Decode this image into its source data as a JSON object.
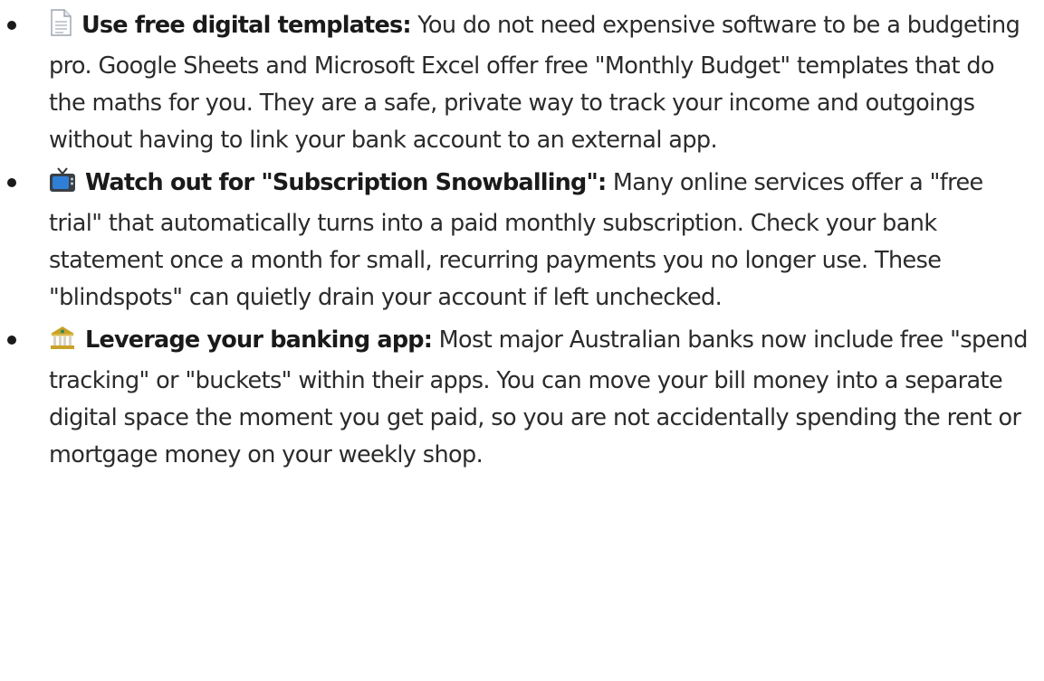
{
  "tips": [
    {
      "icon": "document-icon",
      "title": "Use free digital templates:",
      "body": "You do not need expensive software to be a budgeting pro. Google Sheets and Microsoft Excel offer free \"Monthly Budget\" templates that do the maths for you. They are a safe, private way to track your income and outgoings without having to link your bank account to an external app."
    },
    {
      "icon": "television-icon",
      "title": "Watch out for \"Subscription Snowballing\":",
      "body": "Many online services offer a \"free trial\" that automatically turns into a paid monthly subscription. Check your bank statement once a month for small, recurring payments you no longer use. These \"blindspots\" can quietly drain your account if left unchecked."
    },
    {
      "icon": "bank-icon",
      "title": "Leverage your banking app:",
      "body": "Most major Australian banks now include free \"spend tracking\" or \"buckets\" within their apps. You can move your bill money into a separate digital space the moment you get paid, so you are not accidentally spending the rent or mortgage money on your weekly shop."
    }
  ]
}
